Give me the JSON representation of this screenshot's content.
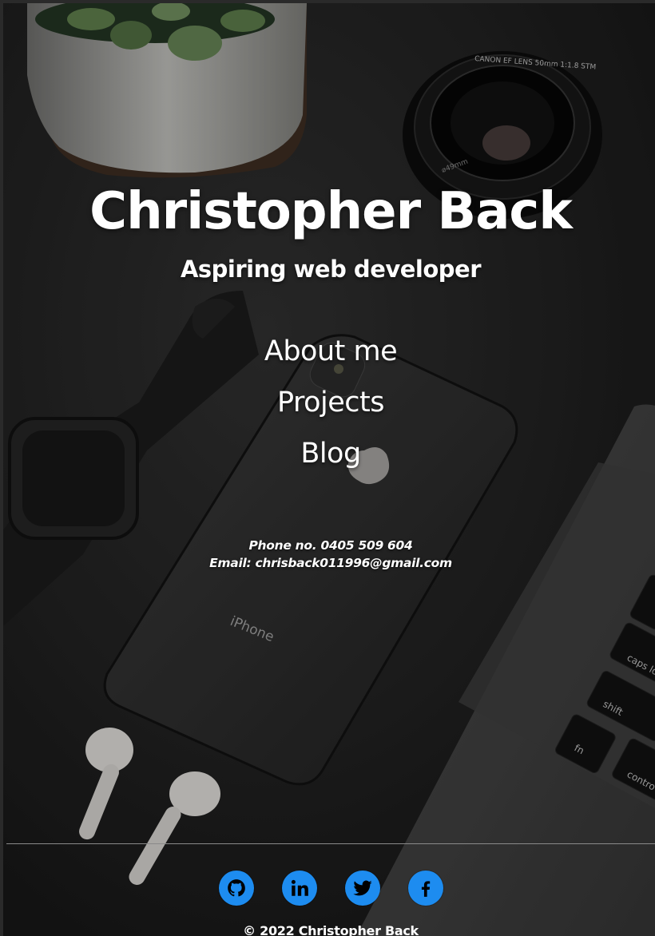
{
  "header": {
    "title": "Christopher Back",
    "subtitle": "Aspiring web developer"
  },
  "nav": {
    "items": [
      {
        "label": "About me"
      },
      {
        "label": "Projects"
      },
      {
        "label": "Blog"
      }
    ]
  },
  "contact": {
    "phone": "Phone no. 0405 509 604",
    "email": "Email: chrisback011996@gmail.com"
  },
  "social": {
    "links": [
      {
        "icon": "github-icon"
      },
      {
        "icon": "linkedin-icon"
      },
      {
        "icon": "twitter-icon"
      },
      {
        "icon": "facebook-icon"
      }
    ],
    "accent": "#1d8cf0"
  },
  "background": {
    "phone_text": "iPhone",
    "lens_text": "CANON EF LENS 50mm 1:1.8 STM",
    "lens_size": "⌀49mm",
    "keys": [
      "caps lo",
      "shift",
      "fn",
      "contro"
    ]
  },
  "footer": {
    "copyright": "© 2022 Christopher Back"
  }
}
